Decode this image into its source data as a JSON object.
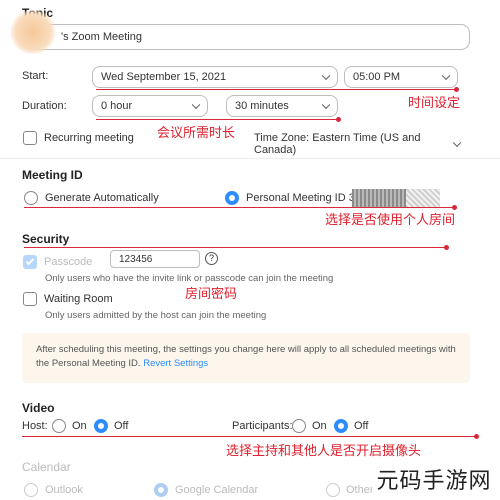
{
  "topic": {
    "label": "Topic",
    "value": "'s Zoom Meeting"
  },
  "start": {
    "label": "Start:",
    "date": "Wed  September  15,  2021",
    "time": "05:00  PM"
  },
  "duration": {
    "label": "Duration:",
    "hours": "0 hour",
    "minutes": "30 minutes"
  },
  "recurring": {
    "label": "Recurring meeting",
    "timezone": "Time Zone: Eastern Time (US and Canada)"
  },
  "meeting_id": {
    "title": "Meeting ID",
    "generate": "Generate Automatically",
    "personal": "Personal Meeting ID",
    "personal_digits": "3"
  },
  "security": {
    "title": "Security",
    "passcode_label": "Passcode",
    "passcode_value": "123456",
    "help": "?",
    "passcode_hint": "Only users who have the invite link or passcode can join the meeting",
    "waiting_room": "Waiting Room",
    "waiting_hint": "Only users admitted by the host can join the meeting"
  },
  "notice": {
    "text": "After scheduling this meeting, the settings you change here will apply to all scheduled meetings with the Personal Meeting ID.",
    "link": "Revert Settings"
  },
  "video": {
    "title": "Video",
    "host_label": "Host:",
    "participants_label": "Participants:",
    "on": "On",
    "off": "Off"
  },
  "calendar": {
    "title": "Calendar",
    "outlook": "Outlook",
    "google": "Google Calendar",
    "other": "Other Calendars"
  },
  "annotations": {
    "time": "时间设定",
    "duration": "会议所需时长",
    "meeting_id": "选择是否使用个人房间",
    "passcode": "房间密码",
    "video": "选择主持和其他人是否开启摄像头"
  },
  "watermark": "元码手游网",
  "colors": {
    "accent": "#2d8cff",
    "annotation": "#e0202e",
    "notice_bg": "#fdf6ec"
  }
}
